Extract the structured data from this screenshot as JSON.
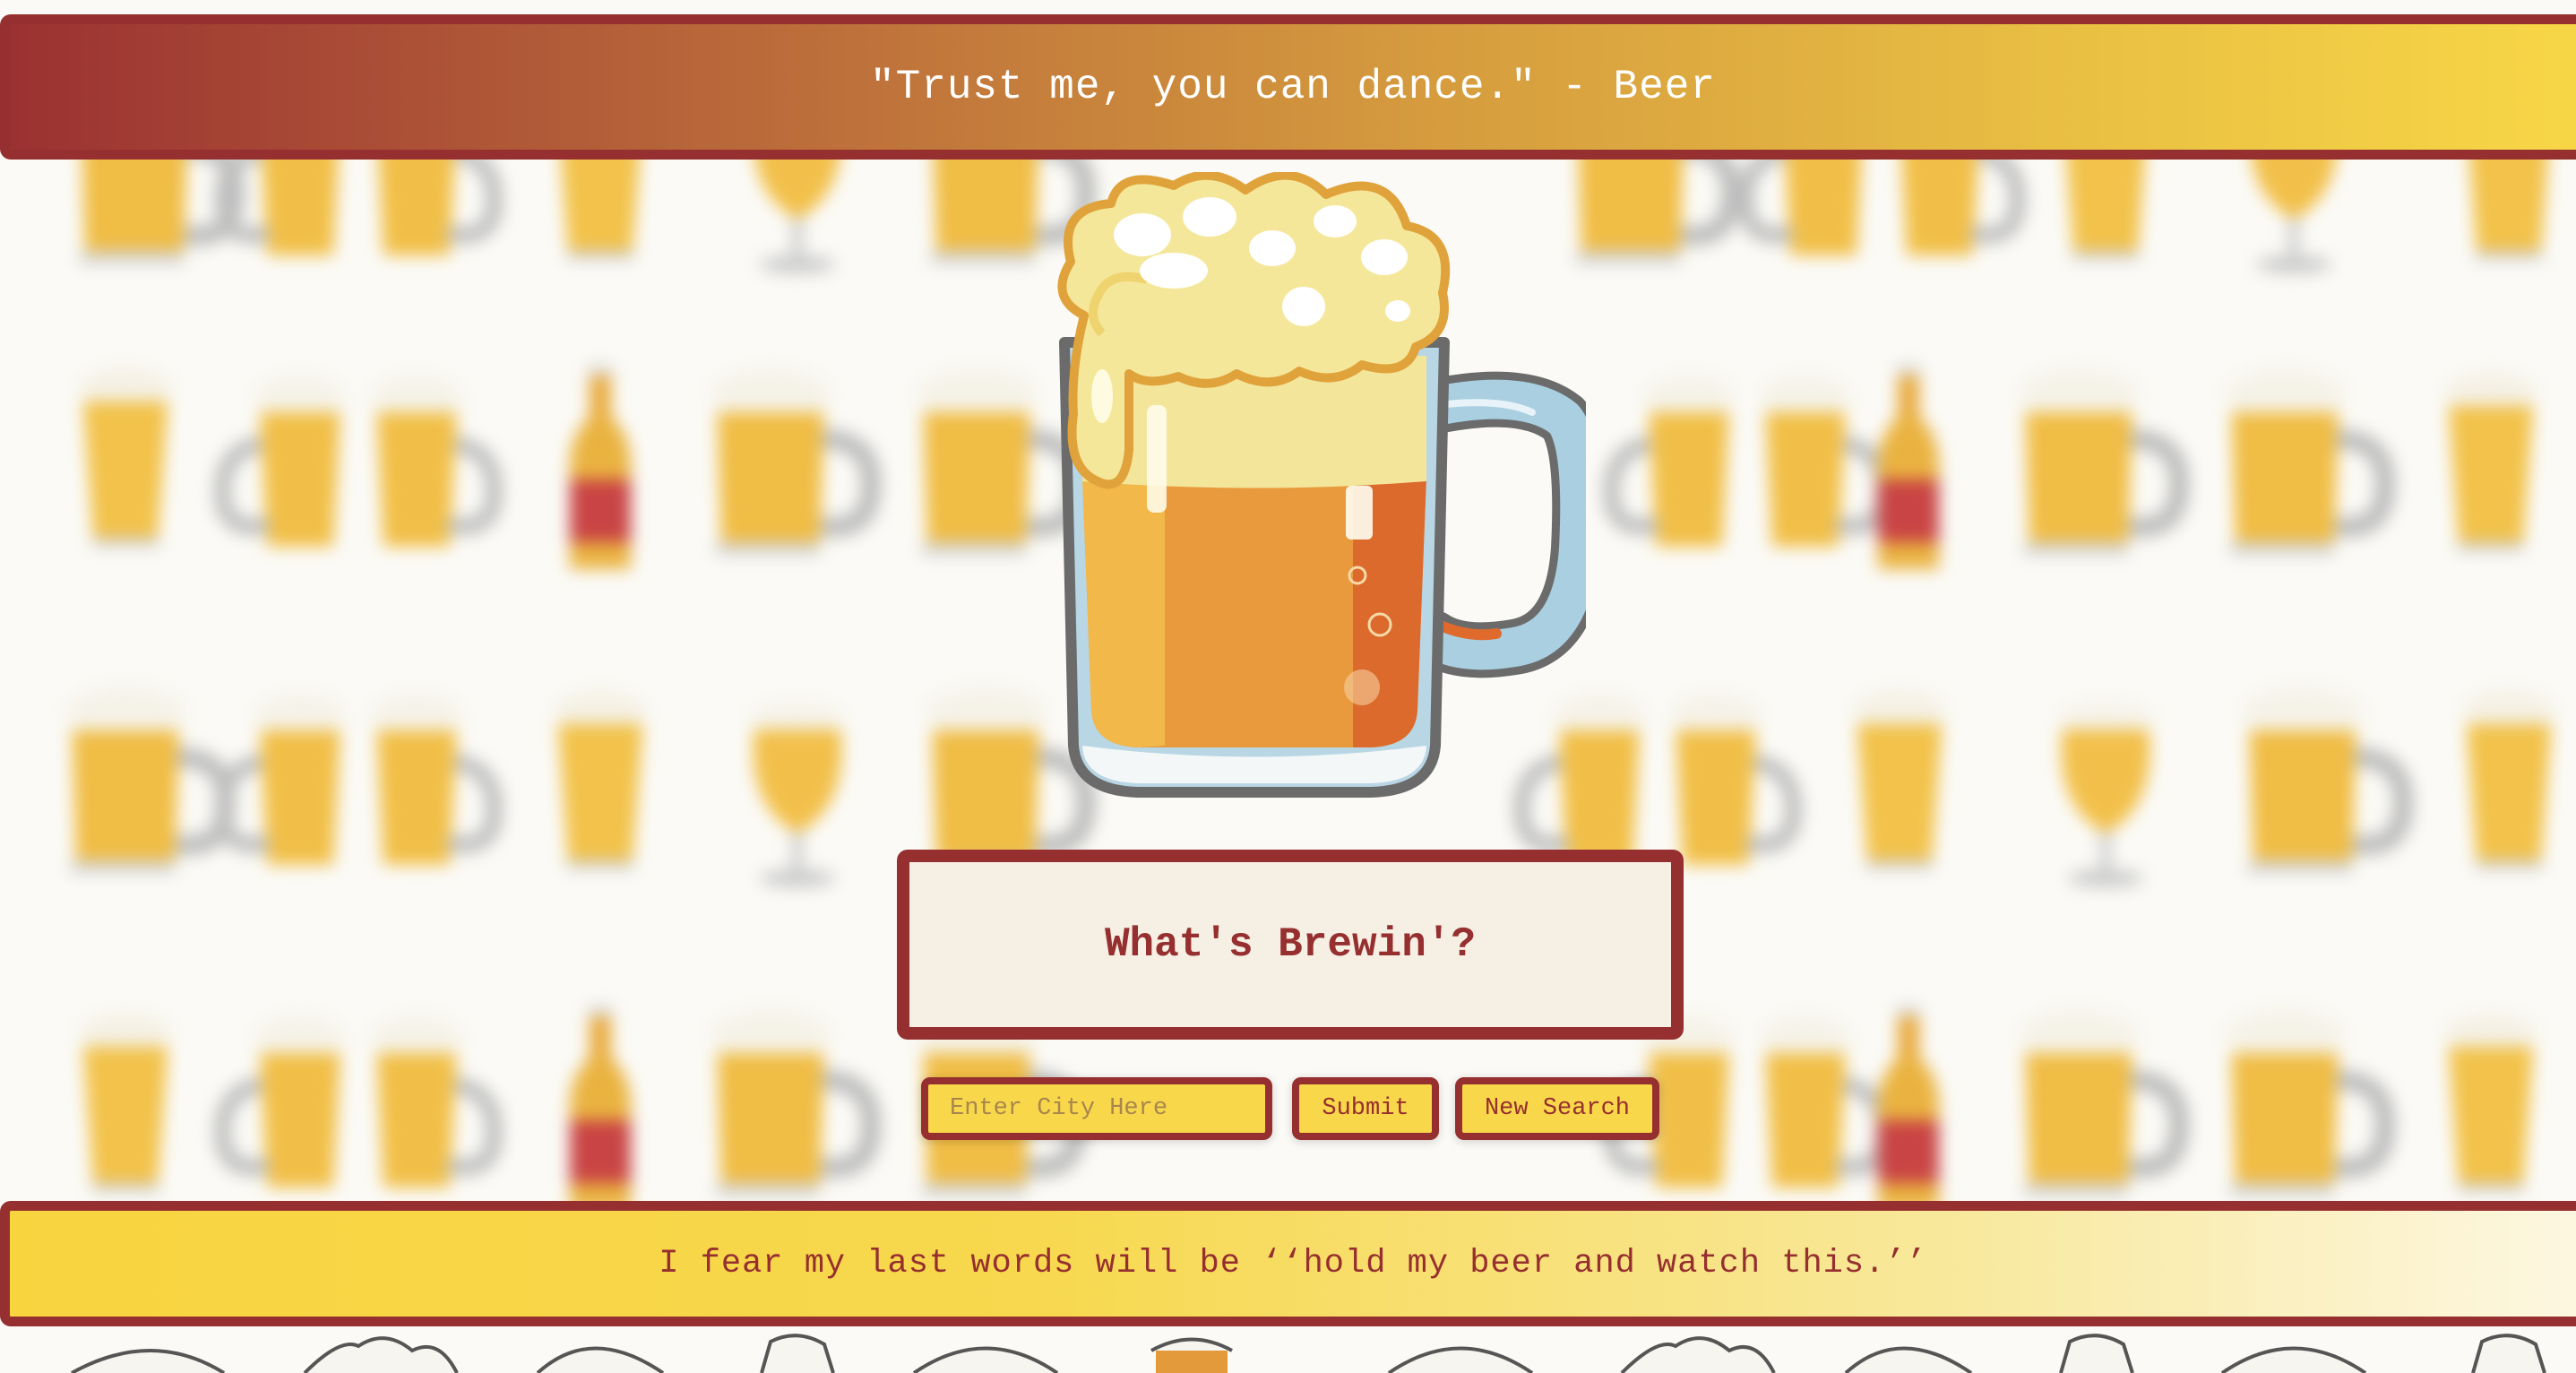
{
  "header": {
    "quote": "\"Trust me, you can dance.\" - Beer"
  },
  "title_card": {
    "title": "What's Brewin'?"
  },
  "search": {
    "city_placeholder": "Enter City Here",
    "city_value": "",
    "submit_label": "Submit",
    "new_search_label": "New Search"
  },
  "footer": {
    "quote": "I fear my last words will be ‘‘hold my beer and watch this.’’"
  },
  "icons": {
    "mascot": "beer-mug-icon",
    "wallpaper": [
      "pint-glass-icon",
      "clinking-mugs-icon",
      "beer-bottle-icon",
      "beer-mug-icon",
      "tulip-glass-icon"
    ]
  },
  "colors": {
    "accent": "#962f2f",
    "header_gradient_start": "#9b3232",
    "header_gradient_end": "#f7d646",
    "footer_gradient_start": "#f8d43f",
    "footer_gradient_end": "#fdf7e1",
    "card_background": "#f6efe3",
    "control_background": "#f8d84a"
  }
}
